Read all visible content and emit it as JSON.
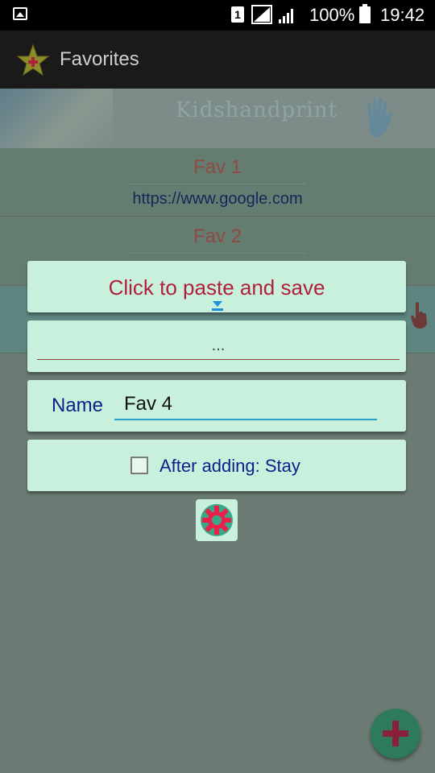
{
  "status_bar": {
    "sim_slot": "1",
    "battery": "100%",
    "time": "19:42"
  },
  "app": {
    "title": "Favorites",
    "icon": "star-icon"
  },
  "banner": {
    "text": "Kidshandprint"
  },
  "favorites": [
    {
      "title": "Fav 1",
      "url": "https://www.google.com"
    },
    {
      "title": "Fav 2",
      "url": ""
    }
  ],
  "dialog": {
    "paste_button_label": "Click to paste and save",
    "url_value": "...",
    "name_label": "Name",
    "name_value": "Fav 4",
    "stay_label": "After adding: Stay",
    "stay_checked": false,
    "settings_icon": "gear-icon"
  },
  "fab": {
    "icon": "plus-icon"
  },
  "colors": {
    "dialog_bg": "#c8f0dc",
    "accent_red": "#b0203a",
    "label_blue": "#0e1f8a",
    "fab": "#2d7a5c"
  }
}
